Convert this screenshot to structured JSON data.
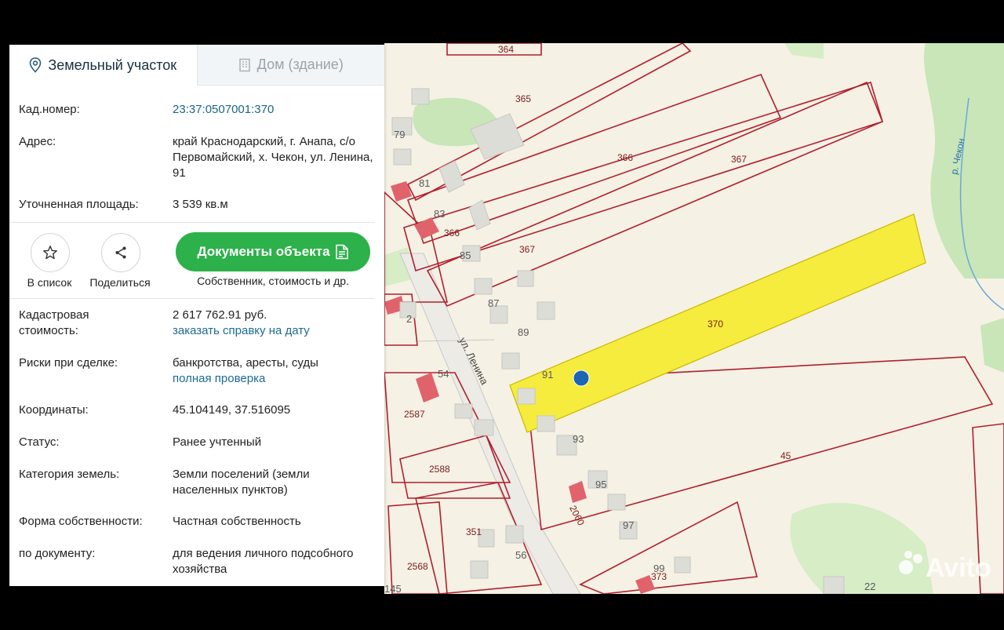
{
  "tabs": {
    "land": "Земельный участок",
    "house": "Дом (здание)"
  },
  "info": {
    "cad_label": "Кад.номер:",
    "cad_value": "23:37:0507001:370",
    "address_label": "Адрес:",
    "address_value": "край Краснодарский, г. Анапа, с/о Первомайский, х. Чекон, ул. Ленина, 91",
    "area_label": "Уточненная площадь:",
    "area_value": "3 539 кв.м",
    "cost_label": "Кадастровая стоимость:",
    "cost_value": "2 617 762.91 руб.",
    "cost_link": "заказать справку на дату",
    "risk_label": "Риски при сделке:",
    "risk_value": "банкротства, аресты, суды",
    "risk_link": "полная проверка",
    "coords_label": "Координаты:",
    "coords_value": "45.104149, 37.516095",
    "status_label": "Статус:",
    "status_value": "Ранее учтенный",
    "category_label": "Категория земель:",
    "category_value": "Земли поселений (земли населенных пунктов)",
    "ownership_label": "Форма собственности:",
    "ownership_value": "Частная собственность",
    "doc_label": "по документу:",
    "doc_value": "для ведения личного подсобного хозяйства"
  },
  "actions": {
    "list_label": "В список",
    "share_label": "Поделиться",
    "docs_button": "Документы объекта",
    "docs_caption": "Собственник, стоимость и др."
  },
  "map": {
    "street": "ул. Ленина",
    "river": "р. Чекон",
    "watermark": "Avito",
    "highlight_color": "#f5ec3d",
    "boundary_color": "#b01f2e",
    "plot_labels": [
      "364",
      "365",
      "366",
      "367",
      "366",
      "367",
      "370",
      "45",
      "2587",
      "2588",
      "351",
      "2568",
      "373",
      "2060"
    ],
    "house_numbers": [
      "79",
      "81",
      "83",
      "85",
      "87",
      "89",
      "91",
      "93",
      "95",
      "97",
      "99",
      "54",
      "56",
      "22",
      "2",
      "145"
    ]
  }
}
